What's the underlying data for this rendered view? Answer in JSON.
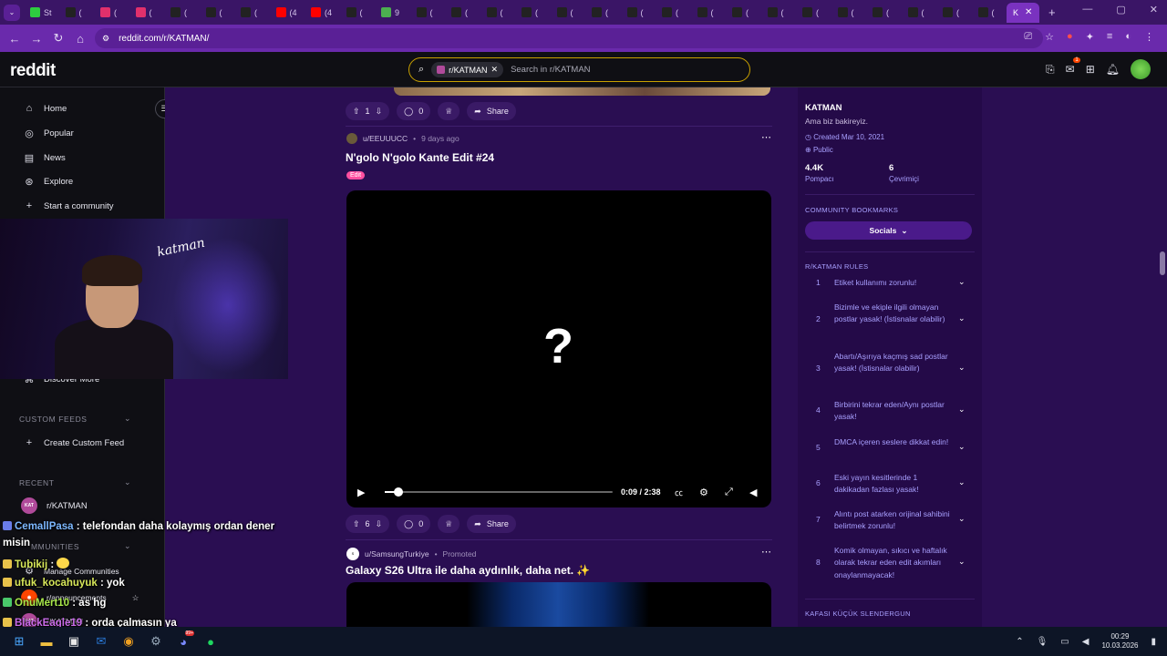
{
  "browser": {
    "tabs": [
      {
        "label": "St",
        "color": "#2ecc40"
      },
      {
        "label": "(",
        "color": "#222"
      },
      {
        "label": "(",
        "color": "#e1306c"
      },
      {
        "label": "(",
        "color": "#e1306c"
      },
      {
        "label": "(",
        "color": "#222"
      },
      {
        "label": "(",
        "color": "#222"
      },
      {
        "label": "(",
        "color": "#222"
      },
      {
        "label": "(4",
        "color": "#ff0000"
      },
      {
        "label": "(4",
        "color": "#ff0000"
      },
      {
        "label": "(",
        "color": "#222"
      },
      {
        "label": "9",
        "color": "#4caf50"
      },
      {
        "label": "(",
        "color": "#222"
      },
      {
        "label": "(",
        "color": "#222"
      },
      {
        "label": "(",
        "color": "#222"
      },
      {
        "label": "(",
        "color": "#222"
      },
      {
        "label": "(",
        "color": "#222"
      },
      {
        "label": "(",
        "color": "#222"
      },
      {
        "label": "(",
        "color": "#222"
      },
      {
        "label": "(",
        "color": "#222"
      },
      {
        "label": "(",
        "color": "#222"
      },
      {
        "label": "(",
        "color": "#222"
      },
      {
        "label": "(",
        "color": "#222"
      },
      {
        "label": "(",
        "color": "#222"
      },
      {
        "label": "(",
        "color": "#222"
      },
      {
        "label": "(",
        "color": "#222"
      },
      {
        "label": "(",
        "color": "#222"
      },
      {
        "label": "(",
        "color": "#222"
      },
      {
        "label": "(",
        "color": "#222"
      }
    ],
    "active_tab": "K",
    "url": "reddit.com/r/KATMAN/"
  },
  "header": {
    "logo": "reddit",
    "search_chip": "r/KATMAN",
    "search_placeholder": "Search in r/KATMAN",
    "notification_count": "1"
  },
  "leftnav": {
    "items": [
      "Home",
      "Popular",
      "News",
      "Explore",
      "Start a community"
    ],
    "discover": "Discover More",
    "custom_feeds_label": "CUSTOM FEEDS",
    "create_custom_feed": "Create Custom Feed",
    "recent_label": "RECENT",
    "recent_item": "r/KATMAN",
    "communities_label": "MMUNITIES",
    "manage_communities": "Manage Communities",
    "community_items": [
      "r/announcements",
      "r/KATMAN"
    ]
  },
  "chat": [
    {
      "user": "CemallPasa",
      "msg": ": telefondan daha kolaymış ordan dener"
    },
    {
      "user": "",
      "msg": "misin"
    },
    {
      "user": "Tubikij",
      "msg": ":"
    },
    {
      "user": "ufuk_kocahuyuk",
      "msg": ": yok"
    },
    {
      "user": "OnuMert10",
      "msg": ": as hg"
    },
    {
      "user": "BlackEagle19",
      "msg": ": orda çalmasın ya"
    }
  ],
  "feed": {
    "post0": {
      "upvotes": "1",
      "comments": "0",
      "share": "Share"
    },
    "post1": {
      "author": "u/EEUUUCC",
      "time": "9 days ago",
      "title": "N'golo N'golo Kante Edit #24",
      "flair": "Edit",
      "video_time": "0:09 / 2:38",
      "video_progress": 0.06,
      "upvotes": "6",
      "comments": "0",
      "share": "Share"
    },
    "post2": {
      "author": "u/SamsungTurkiye",
      "promoted": "Promoted",
      "title": "Galaxy S26 Ultra ile daha aydınlık, daha net. ✨"
    }
  },
  "sidebar": {
    "name": "KATMAN",
    "tagline": "Ama biz bakireyiz.",
    "created": "Created Mar 10, 2021",
    "visibility": "Public",
    "members": "4.4K",
    "members_label": "Pompacı",
    "online": "6",
    "online_label": "Çevrimiçi",
    "bookmarks_label": "COMMUNITY BOOKMARKS",
    "socials": "Socials",
    "rules_label": "R/KATMAN RULES",
    "rules": [
      "Etiket kullanımı zorunlu!",
      "Bizimle ve ekiple ilgili olmayan postlar yasak! (İstisnalar olabilir)",
      "Abartı/Aşırıya kaçmış sad postlar yasak! (İstisnalar olabilir)",
      "Birbirini tekrar eden/Aynı postlar yasak!",
      "DMCA içeren seslere dikkat edin!",
      "Eski yayın kesitlerinde 1 dakikadan fazlası yasak!",
      "Alıntı post atarken orijinal sahibini belirtmek zorunlu!",
      "Komik olmayan, sıkıcı ve haftalık olarak tekrar eden edit akımları onaylanmayacak!"
    ],
    "next_section": "KAFASI KÜÇÜK SLENDERGUN"
  },
  "taskbar": {
    "time": "00:29",
    "date": "10.03.2026",
    "discord_badge": "99+"
  },
  "webcam": {
    "signature": "katman"
  }
}
